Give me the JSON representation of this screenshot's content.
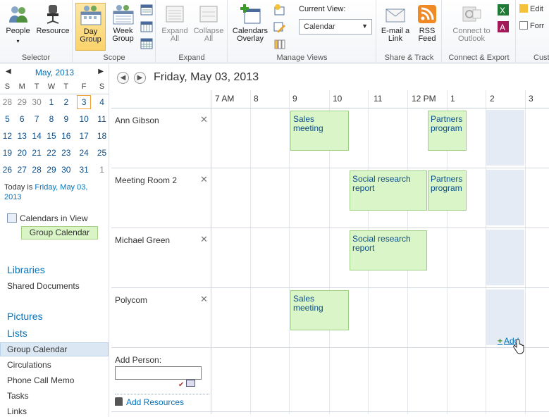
{
  "ribbon": {
    "groups": {
      "selector": "Selector",
      "scope": "Scope",
      "expand": "Expand",
      "manage_views": "Manage Views",
      "share_track": "Share & Track",
      "connect_export": "Connect & Export",
      "customize": "Cust"
    },
    "buttons": {
      "people": "People",
      "resource": "Resource",
      "day_group_1": "Day",
      "day_group_2": "Group",
      "week_group_1": "Week",
      "week_group_2": "Group",
      "expand_all_1": "Expand",
      "expand_all_2": "All",
      "collapse_all_1": "Collapse",
      "collapse_all_2": "All",
      "calendars_overlay_1": "Calendars",
      "calendars_overlay_2": "Overlay",
      "email_link_1": "E-mail a",
      "email_link_2": "Link",
      "rss_feed_1": "RSS",
      "rss_feed_2": "Feed",
      "connect_outlook_1": "Connect to",
      "connect_outlook_2": "Outlook",
      "edit": "Edit",
      "form": "Forr"
    },
    "current_view_label": "Current View:",
    "current_view_value": "Calendar"
  },
  "minical": {
    "title": "May, 2013",
    "weekdays": [
      "S",
      "M",
      "T",
      "W",
      "T",
      "F",
      "S"
    ],
    "weeks": [
      [
        "28",
        "29",
        "30",
        "1",
        "2",
        "3",
        "4"
      ],
      [
        "5",
        "6",
        "7",
        "8",
        "9",
        "10",
        "11"
      ],
      [
        "12",
        "13",
        "14",
        "15",
        "16",
        "17",
        "18"
      ],
      [
        "19",
        "20",
        "21",
        "22",
        "23",
        "24",
        "25"
      ],
      [
        "26",
        "27",
        "28",
        "29",
        "30",
        "31",
        "1"
      ]
    ],
    "today_prefix": "Today is ",
    "today_date": "Friday, May 03,",
    "today_year": "2013"
  },
  "leftnav": {
    "calendars_in_view": "Calendars in View",
    "group_calendar_chip": "Group Calendar",
    "libraries": "Libraries",
    "shared_documents": "Shared Documents",
    "pictures": "Pictures",
    "lists": "Lists",
    "group_calendar": "Group Calendar",
    "circulations": "Circulations",
    "phone_call_memo": "Phone Call Memo",
    "tasks": "Tasks",
    "links": "Links"
  },
  "main": {
    "date_title": "Friday, May 03, 2013",
    "hours": [
      "7 AM",
      "8",
      "9",
      "10",
      "11",
      "12 PM",
      "1",
      "2",
      "3"
    ],
    "people": [
      "Ann Gibson",
      "Meeting Room 2",
      "Michael Green",
      "Polycom"
    ],
    "events": {
      "sales_meeting_1": "Sales meeting",
      "partners_program_1": "Partners program",
      "social_research_1": "Social research report",
      "partners_program_2": "Partners program",
      "social_research_2": "Social research report",
      "sales_meeting_2": "Sales meeting"
    },
    "add_person_label": "Add Person:",
    "add_resources": "Add Resources",
    "add_link": "Add"
  }
}
